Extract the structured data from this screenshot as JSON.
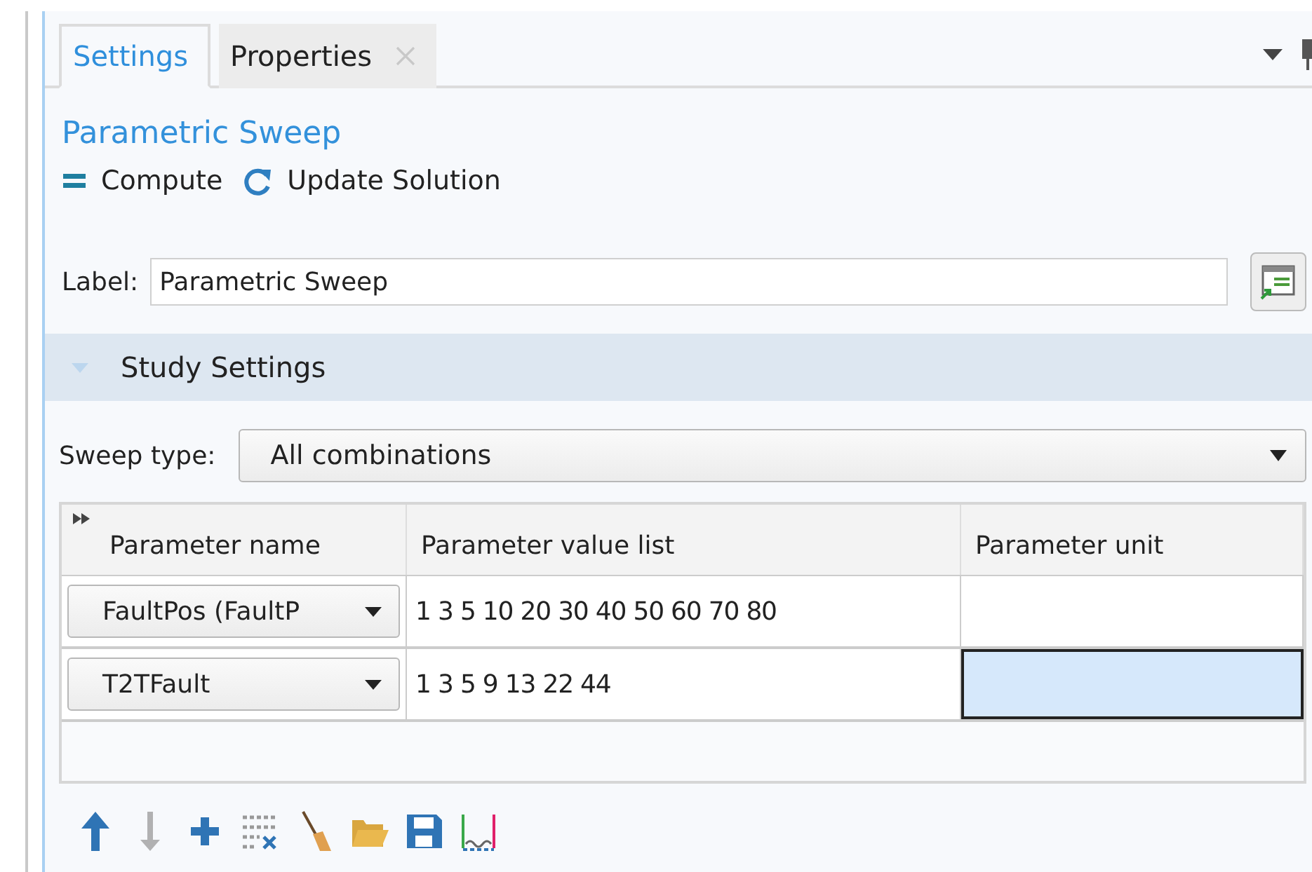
{
  "tabs": [
    {
      "label": "Settings",
      "selected": true,
      "closable": false
    },
    {
      "label": "Properties",
      "selected": false,
      "closable": true
    }
  ],
  "title": "Parametric Sweep",
  "toolbar": [
    {
      "kind": "compute",
      "label": "Compute"
    },
    {
      "kind": "update",
      "label": "Update Solution"
    }
  ],
  "label_field": {
    "label": "Label:",
    "value": "Parametric Sweep"
  },
  "section": {
    "title": "Study Settings",
    "expanded": true
  },
  "sweep_type": {
    "label": "Sweep type:",
    "value": "All combinations"
  },
  "table": {
    "columns": [
      "Parameter name",
      "Parameter value list",
      "Parameter unit"
    ],
    "rows": [
      {
        "name": "FaultPos (FaultP",
        "value_list": "1 3 5 10 20 30 40 50 60 70 80",
        "unit_selected": false
      },
      {
        "name": "T2TFault",
        "value_list": "1 3 5 9 13 22 44",
        "unit_selected": true
      }
    ]
  },
  "table_tools": [
    {
      "kind": "up",
      "disabled": false
    },
    {
      "kind": "down",
      "disabled": true
    },
    {
      "kind": "add",
      "disabled": false
    },
    {
      "kind": "clear",
      "disabled": false
    },
    {
      "kind": "broom",
      "disabled": false
    },
    {
      "kind": "open",
      "disabled": false
    },
    {
      "kind": "save",
      "disabled": false
    },
    {
      "kind": "range",
      "disabled": false
    }
  ]
}
